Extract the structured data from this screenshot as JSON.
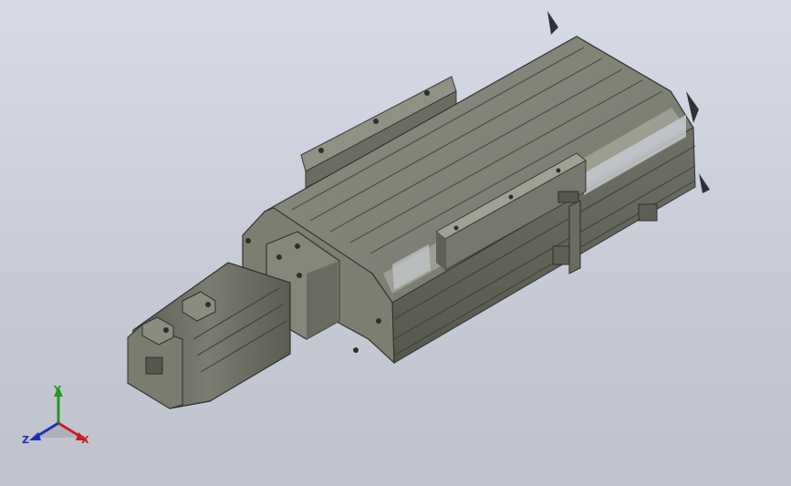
{
  "viewport": {
    "background_top": "#d7dbe7",
    "background_bottom": "#bfc3cd",
    "body_color": "#7d7f73",
    "rail_color": "#9a9c90",
    "dark_shade": "#4f5148"
  },
  "triad": {
    "x_label": "X",
    "y_label": "Y",
    "z_label": "Z",
    "x_color": "#c81e1e",
    "y_color": "#1e9a1e",
    "z_color": "#1e2fb5"
  }
}
